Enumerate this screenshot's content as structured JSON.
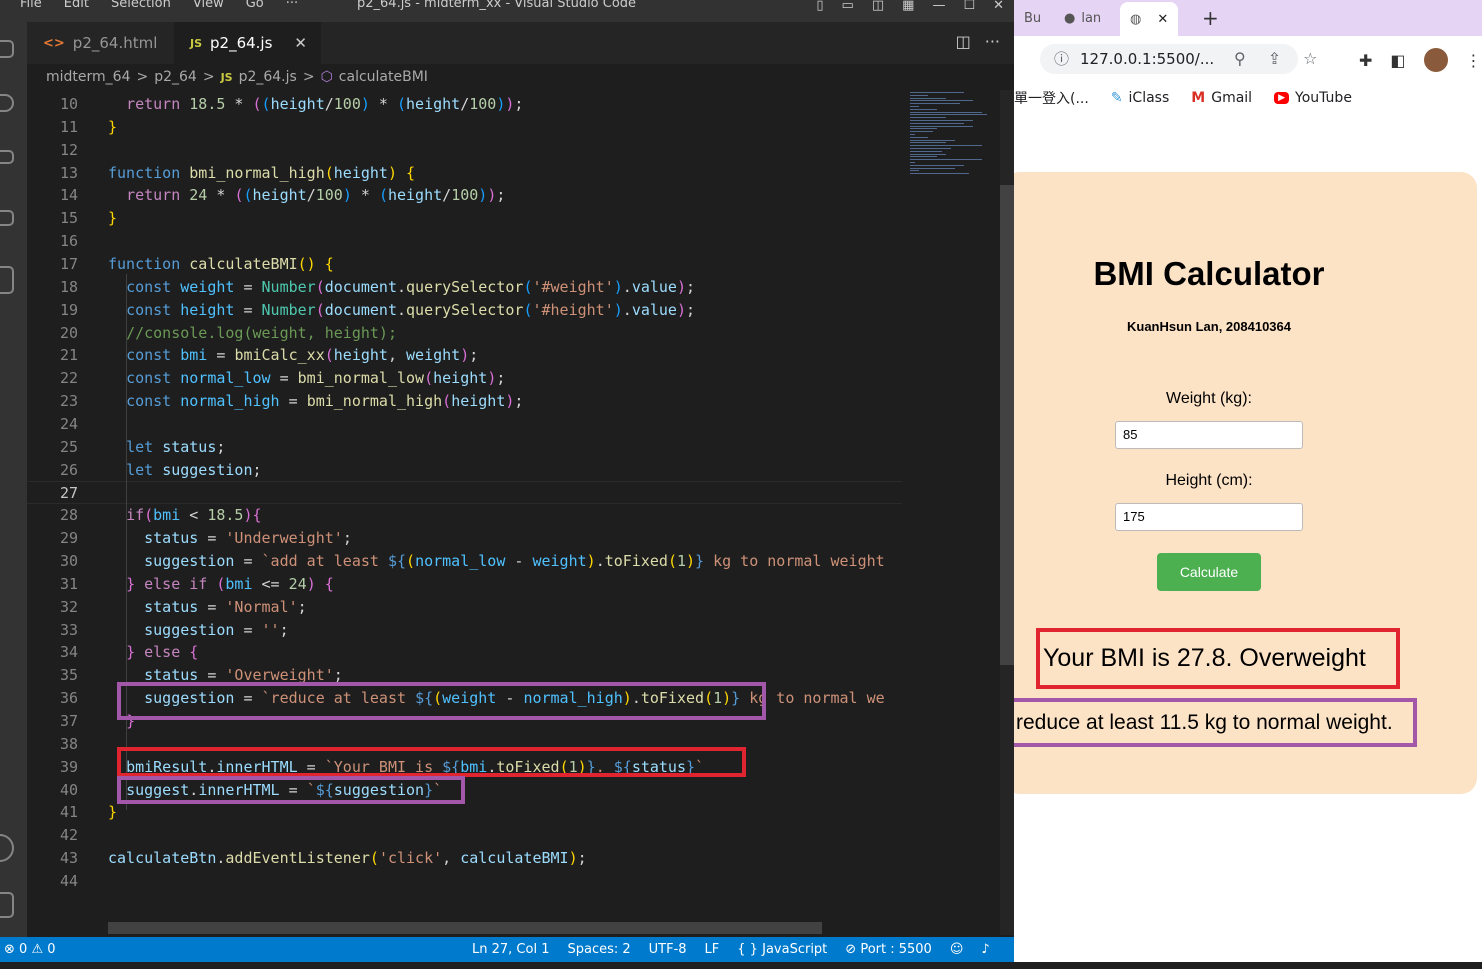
{
  "vscode": {
    "menu": [
      "File",
      "Edit",
      "Selection",
      "View",
      "Go",
      "···"
    ],
    "title": "p2_64.js - midterm_xx - Visual Studio Code",
    "tabs": [
      {
        "label": "p2_64.html",
        "active": false
      },
      {
        "label": "p2_64.js",
        "active": true
      }
    ],
    "breadcrumb": [
      "midterm_64",
      ">",
      "p2_64",
      ">",
      "JS",
      "p2_64.js",
      ">",
      "calculateBMI"
    ],
    "code_lines": [
      {
        "n": "10",
        "html": "  <span class='c'>return</span> <span class='n'>18.5</span> * <span class='b2'>(</span><span class='b3'>(</span><span class='v'>height</span>/<span class='n'>100</span><span class='b3'>)</span> * <span class='b3'>(</span><span class='v'>height</span>/<span class='n'>100</span><span class='b3'>)</span><span class='b2'>)</span>;"
      },
      {
        "n": "11",
        "html": "<span class='b1'>}</span>"
      },
      {
        "n": "12",
        "html": ""
      },
      {
        "n": "13",
        "html": "<span class='k'>function</span> <span class='f'>bmi_normal_high</span><span class='b1'>(</span><span class='v'>height</span><span class='b1'>)</span> <span class='b1'>{</span>"
      },
      {
        "n": "14",
        "html": "  <span class='c'>return</span> <span class='n'>24</span> * <span class='b2'>(</span><span class='b3'>(</span><span class='v'>height</span>/<span class='n'>100</span><span class='b3'>)</span> * <span class='b3'>(</span><span class='v'>height</span>/<span class='n'>100</span><span class='b3'>)</span><span class='b2'>)</span>;"
      },
      {
        "n": "15",
        "html": "<span class='b1'>}</span>"
      },
      {
        "n": "16",
        "html": ""
      },
      {
        "n": "17",
        "html": "<span class='k'>function</span> <span class='f'>calculateBMI</span><span class='b1'>()</span> <span class='b1'>{</span>"
      },
      {
        "n": "18",
        "html": "  <span class='k'>const</span> <span class='ob'>weight</span> = <span class='ty'>Number</span><span class='b2'>(</span><span class='v'>document</span>.<span class='f'>querySelector</span><span class='b3'>(</span><span class='s'>'#weight'</span><span class='b3'>)</span>.<span class='v'>value</span><span class='b2'>)</span>;"
      },
      {
        "n": "19",
        "html": "  <span class='k'>const</span> <span class='ob'>height</span> = <span class='ty'>Number</span><span class='b2'>(</span><span class='v'>document</span>.<span class='f'>querySelector</span><span class='b3'>(</span><span class='s'>'#height'</span><span class='b3'>)</span>.<span class='v'>value</span><span class='b2'>)</span>;"
      },
      {
        "n": "20",
        "html": "  <span class='cm'>//console.log(weight, height);</span>"
      },
      {
        "n": "21",
        "html": "  <span class='k'>const</span> <span class='ob'>bmi</span> = <span class='f'>bmiCalc_xx</span><span class='b2'>(</span><span class='v'>height</span>, <span class='v'>weight</span><span class='b2'>)</span>;"
      },
      {
        "n": "22",
        "html": "  <span class='k'>const</span> <span class='ob'>normal_low</span> = <span class='f'>bmi_normal_low</span><span class='b2'>(</span><span class='v'>height</span><span class='b2'>)</span>;"
      },
      {
        "n": "23",
        "html": "  <span class='k'>const</span> <span class='ob'>normal_high</span> = <span class='f'>bmi_normal_high</span><span class='b2'>(</span><span class='v'>height</span><span class='b2'>)</span>;"
      },
      {
        "n": "24",
        "html": ""
      },
      {
        "n": "25",
        "html": "  <span class='k'>let</span> <span class='v'>status</span>;"
      },
      {
        "n": "26",
        "html": "  <span class='k'>let</span> <span class='v'>suggestion</span>;"
      },
      {
        "n": "27",
        "html": ""
      },
      {
        "n": "28",
        "html": "  <span class='c'>if</span><span class='b2'>(</span><span class='ob'>bmi</span> &lt; <span class='n'>18.5</span><span class='b2'>)</span><span class='b2'>{</span>"
      },
      {
        "n": "29",
        "html": "    <span class='v'>status</span> = <span class='s'>'Underweight'</span>;"
      },
      {
        "n": "30",
        "html": "    <span class='v'>suggestion</span> = <span class='s'>`add at least </span><span class='k'>${</span><span class='b1'>(</span><span class='ob'>normal_low</span> - <span class='ob'>weight</span><span class='b1'>)</span>.<span class='f'>toFixed</span><span class='b1'>(</span><span class='n'>1</span><span class='b1'>)</span><span class='k'>}</span><span class='s'> kg to normal weight</span>"
      },
      {
        "n": "31",
        "html": "  <span class='b2'>}</span> <span class='c'>else if</span> <span class='b2'>(</span><span class='ob'>bmi</span> &lt;= <span class='n'>24</span><span class='b2'>)</span> <span class='b2'>{</span>"
      },
      {
        "n": "32",
        "html": "    <span class='v'>status</span> = <span class='s'>'Normal'</span>;"
      },
      {
        "n": "33",
        "html": "    <span class='v'>suggestion</span> = <span class='s'>''</span>;"
      },
      {
        "n": "34",
        "html": "  <span class='b2'>}</span> <span class='c'>else</span> <span class='b2'>{</span>"
      },
      {
        "n": "35",
        "html": "    <span class='v'>status</span> = <span class='s'>'Overweight'</span>;"
      },
      {
        "n": "36",
        "html": "    <span class='v'>suggestion</span> = <span class='s'>`reduce at least </span><span class='k'>${</span><span class='b1'>(</span><span class='ob'>weight</span> - <span class='ob'>normal_high</span><span class='b1'>)</span>.<span class='f'>toFixed</span><span class='b1'>(</span><span class='n'>1</span><span class='b1'>)</span><span class='k'>}</span><span class='s'> kg to normal we</span>"
      },
      {
        "n": "37",
        "html": "  <span class='b2'>}</span>"
      },
      {
        "n": "38",
        "html": ""
      },
      {
        "n": "39",
        "html": "  <span class='v'>bmiResult</span>.<span class='v'>innerHTML</span> = <span class='s'>`Your BMI is </span><span class='k'>${</span><span class='ob'>bmi</span>.<span class='f'>toFixed</span><span class='b1'>(</span><span class='n'>1</span><span class='b1'>)</span><span class='k'>}</span><span class='s'>. </span><span class='k'>${</span><span class='v'>status</span><span class='k'>}</span><span class='s'>`</span>"
      },
      {
        "n": "40",
        "html": "  <span class='v'>suggest</span>.<span class='v'>innerHTML</span> = <span class='s'>`</span><span class='k'>${</span><span class='v'>suggestion</span><span class='k'>}</span><span class='s'>`</span>"
      },
      {
        "n": "41",
        "html": "<span class='b1'>}</span>"
      },
      {
        "n": "42",
        "html": ""
      },
      {
        "n": "43",
        "html": "<span class='v'>calculateBtn</span>.<span class='f'>addEventListener</span><span class='b1'>(</span><span class='s'>'click'</span>, <span class='v'>calculateBMI</span><span class='b1'>)</span>;"
      },
      {
        "n": "44",
        "html": ""
      }
    ],
    "current_line": "27",
    "status": {
      "errors": "0",
      "warnings": "0",
      "position": "Ln 27, Col 1",
      "spaces": "Spaces: 2",
      "encoding": "UTF-8",
      "eol": "LF",
      "language": "JavaScript",
      "port": "Port : 5500"
    }
  },
  "chrome": {
    "tabs": [
      {
        "label": "Bu"
      },
      {
        "label": "lan"
      },
      {
        "label": "",
        "active": true
      }
    ],
    "url": "127.0.0.1:5500/...",
    "bookmarks": [
      {
        "label": "單一登入(..."
      },
      {
        "label": "iClass"
      },
      {
        "label": "Gmail"
      },
      {
        "label": "YouTube"
      }
    ]
  },
  "page": {
    "title": "BMI Calculator",
    "author": "KuanHsun Lan, 208410364",
    "weight_label": "Weight (kg):",
    "weight_value": "85",
    "height_label": "Height (cm):",
    "height_value": "175",
    "calculate_label": "Calculate",
    "result": "Your BMI is 27.8. Overweight",
    "suggestion": "reduce at least 11.5 kg to normal weight."
  },
  "colors": {
    "highlight_red": "#e02430",
    "highlight_purple": "#a257a8",
    "card_bg": "#fde3c6",
    "button_green": "#4caf50"
  }
}
